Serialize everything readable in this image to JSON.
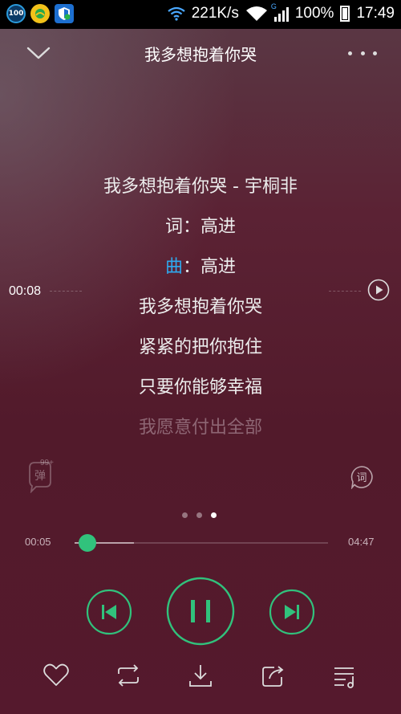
{
  "status_bar": {
    "net_speed": "221K/s",
    "network_type": "G",
    "battery": "100%",
    "time": "17:49",
    "left_icons": [
      "battery-saver-icon",
      "qq-browser-icon",
      "security-shield-icon"
    ],
    "left_icon_text": "100"
  },
  "header": {
    "title": "我多想抱着你哭"
  },
  "lyrics": {
    "lines": [
      {
        "pre": "",
        "highlight": "",
        "text": "我多想抱着你哭 - 宇桐非"
      },
      {
        "pre": "",
        "highlight": "",
        "text": "词：高进"
      },
      {
        "pre": "",
        "highlight": "曲",
        "text": "：高进"
      },
      {
        "pre": "",
        "highlight": "",
        "text": "我多想抱着你哭"
      },
      {
        "pre": "",
        "highlight": "",
        "text": "紧紧的把你抱住"
      },
      {
        "pre": "",
        "highlight": "",
        "text": "只要你能够幸福"
      },
      {
        "pre": "",
        "highlight": "",
        "text": "我愿意付出全部"
      }
    ],
    "marker_time": "00:08"
  },
  "danmu": {
    "label": "弹",
    "count": "99+"
  },
  "lyrics_button_label": "词",
  "page_dots": {
    "count": 3,
    "active": 2
  },
  "progress": {
    "current": "00:05",
    "total": "04:47",
    "played_fraction": 0.05,
    "buffered_fraction": 0.235
  },
  "colors": {
    "accent": "#31c27c",
    "lyric_highlight": "#2eaaf0"
  }
}
